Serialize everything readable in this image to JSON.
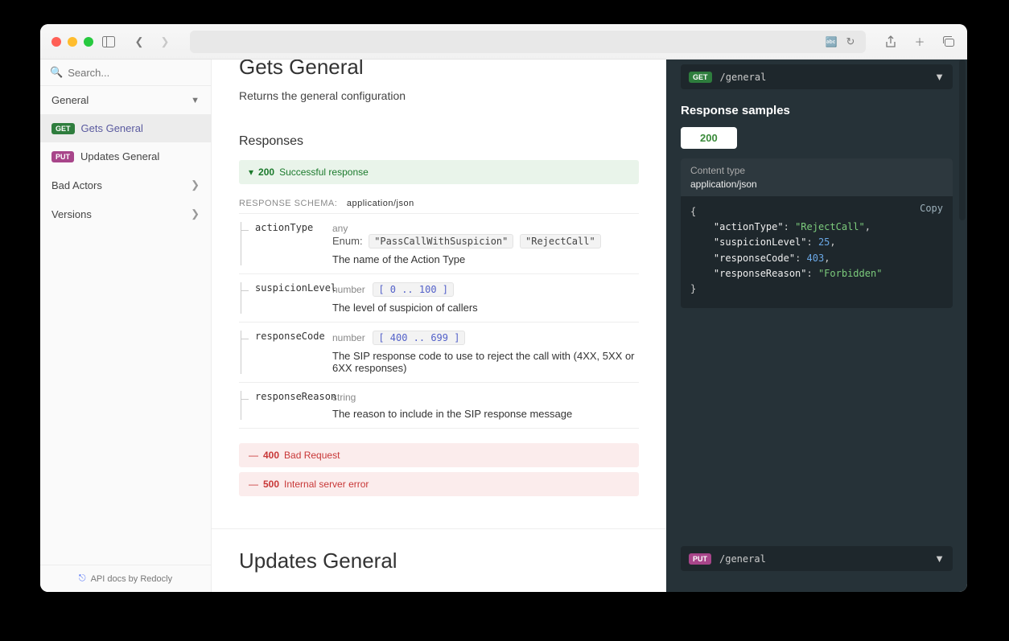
{
  "search": {
    "placeholder": "Search..."
  },
  "sidebar": {
    "groups": [
      {
        "label": "General",
        "expanded": true
      },
      {
        "label": "Bad Actors",
        "expanded": false
      },
      {
        "label": "Versions",
        "expanded": false
      }
    ],
    "items": [
      {
        "method": "GET",
        "label": "Gets General"
      },
      {
        "method": "PUT",
        "label": "Updates General"
      }
    ],
    "credit": "API docs by Redocly"
  },
  "section1": {
    "title": "Gets General",
    "desc": "Returns the general configuration",
    "responses_heading": "Responses",
    "ok": {
      "code": "200",
      "text": "Successful response"
    },
    "schema_label": "RESPONSE SCHEMA:",
    "schema_ct": "application/json",
    "fields": [
      {
        "name": "actionType",
        "type": "any",
        "enum_label": "Enum:",
        "enums": [
          "\"PassCallWithSuspicion\"",
          "\"RejectCall\""
        ],
        "desc": "The name of the Action Type"
      },
      {
        "name": "suspicionLevel",
        "type": "number",
        "constraint": "[ 0 .. 100 ]",
        "desc": "The level of suspicion of callers"
      },
      {
        "name": "responseCode",
        "type": "number",
        "constraint": "[ 400 .. 699 ]",
        "desc": "The SIP response code to use to reject the call with (4XX, 5XX or 6XX responses)"
      },
      {
        "name": "responseReason",
        "type": "string",
        "desc": "The reason to include in the SIP response message"
      }
    ],
    "errs": [
      {
        "code": "400",
        "text": "Bad Request"
      },
      {
        "code": "500",
        "text": "Internal server error"
      }
    ]
  },
  "section2": {
    "title": "Updates General"
  },
  "right": {
    "endpoint1": {
      "method": "GET",
      "path": "/general"
    },
    "samples_title": "Response samples",
    "tab": "200",
    "ct_label": "Content type",
    "ct_val": "application/json",
    "copy": "Copy",
    "json": {
      "k1": "\"actionType\"",
      "v1": "\"RejectCall\"",
      "k2": "\"suspicionLevel\"",
      "v2": "25",
      "k3": "\"responseCode\"",
      "v3": "403",
      "k4": "\"responseReason\"",
      "v4": "\"Forbidden\""
    },
    "endpoint2": {
      "method": "PUT",
      "path": "/general"
    }
  }
}
